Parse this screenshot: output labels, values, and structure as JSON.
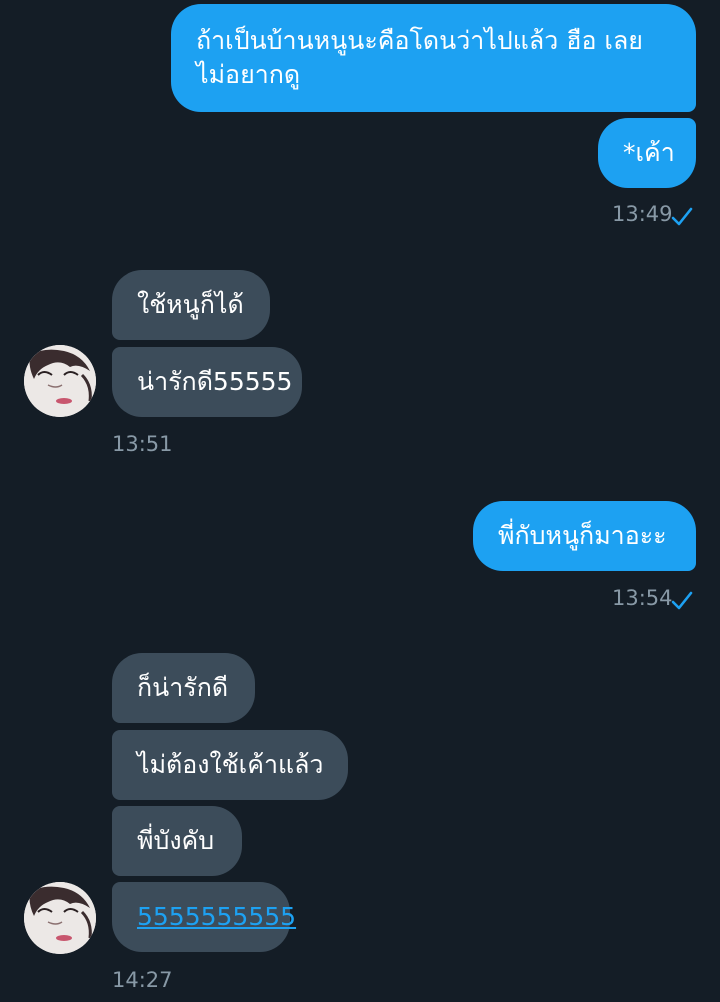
{
  "messages": {
    "sent_1_line_1": "ถ้าเป็นบ้านหนูนะคือโดนว่าไปแล้ว ฮือ เลย",
    "sent_1_line_2": "ไม่อยากดู",
    "sent_2": "*เค้า",
    "time_1": "13:49",
    "recv_1": "ใช้หนูก็ได้",
    "recv_2": "น่ารักดี55555",
    "time_2": "13:51",
    "sent_3": "พี่กับหนูก็มาอะะ",
    "time_3": "13:54",
    "recv_3": "ก็น่ารักดี",
    "recv_4": "ไม่ต้องใช้เค้าแล้ว",
    "recv_5": "พี่บังคับ",
    "recv_6_link": "5555555555",
    "time_4": "14:27"
  },
  "icons": {
    "read_receipt": "check-icon",
    "avatar": "avatar-image"
  },
  "colors": {
    "background": "#141d26",
    "sent_bubble": "#1da1f2",
    "received_bubble": "#3c4c5a",
    "timestamp": "#8899a6",
    "link": "#1da1f2"
  }
}
